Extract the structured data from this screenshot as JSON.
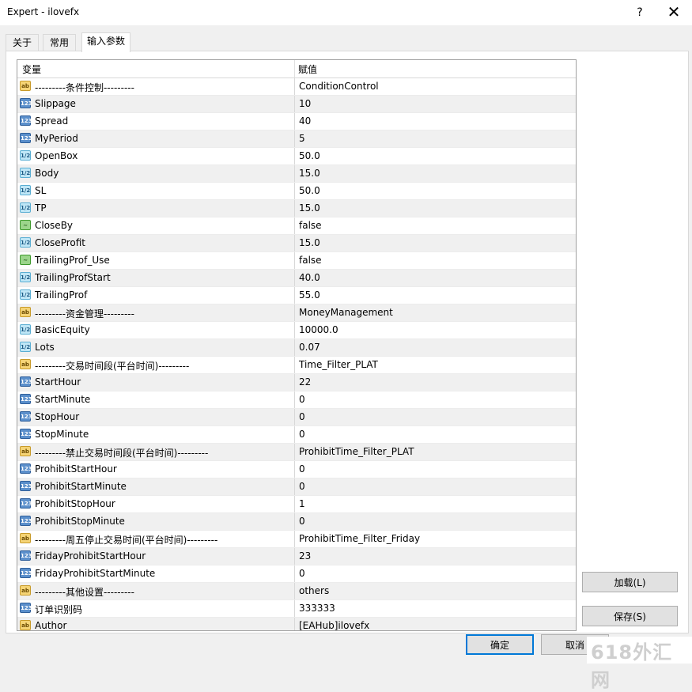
{
  "window": {
    "title": "Expert - ilovefx",
    "help_glyph": "?",
    "close_glyph": "✕"
  },
  "tabs": [
    "关于",
    "常用",
    "输入参数"
  ],
  "grid": {
    "headers": {
      "variable": "变量",
      "value": "赋值"
    },
    "rows": [
      {
        "type": "ab",
        "name": "---------条件控制---------",
        "value": "ConditionControl"
      },
      {
        "type": "int",
        "name": "Slippage",
        "value": "10"
      },
      {
        "type": "int",
        "name": "Spread",
        "value": "40"
      },
      {
        "type": "int",
        "name": "MyPeriod",
        "value": "5"
      },
      {
        "type": "dbl",
        "name": "OpenBox",
        "value": "50.0"
      },
      {
        "type": "dbl",
        "name": "Body",
        "value": "15.0"
      },
      {
        "type": "dbl",
        "name": "SL",
        "value": "50.0"
      },
      {
        "type": "dbl",
        "name": "TP",
        "value": "15.0"
      },
      {
        "type": "bool",
        "name": "CloseBy",
        "value": "false"
      },
      {
        "type": "dbl",
        "name": "CloseProfit",
        "value": "15.0"
      },
      {
        "type": "bool",
        "name": "TrailingProf_Use",
        "value": "false"
      },
      {
        "type": "dbl",
        "name": "TrailingProfStart",
        "value": "40.0"
      },
      {
        "type": "dbl",
        "name": "TrailingProf",
        "value": "55.0"
      },
      {
        "type": "ab",
        "name": "---------资金管理---------",
        "value": "MoneyManagement"
      },
      {
        "type": "dbl",
        "name": "BasicEquity",
        "value": "10000.0"
      },
      {
        "type": "dbl",
        "name": "Lots",
        "value": "0.07"
      },
      {
        "type": "ab",
        "name": "---------交易时间段(平台时间)---------",
        "value": "Time_Filter_PLAT"
      },
      {
        "type": "int",
        "name": "StartHour",
        "value": "22"
      },
      {
        "type": "int",
        "name": "StartMinute",
        "value": "0"
      },
      {
        "type": "int",
        "name": "StopHour",
        "value": "0"
      },
      {
        "type": "int",
        "name": "StopMinute",
        "value": "0"
      },
      {
        "type": "ab",
        "name": "---------禁止交易时间段(平台时间)---------",
        "value": "ProhibitTime_Filter_PLAT"
      },
      {
        "type": "int",
        "name": "ProhibitStartHour",
        "value": "0"
      },
      {
        "type": "int",
        "name": "ProhibitStartMinute",
        "value": "0"
      },
      {
        "type": "int",
        "name": "ProhibitStopHour",
        "value": "1"
      },
      {
        "type": "int",
        "name": "ProhibitStopMinute",
        "value": "0"
      },
      {
        "type": "ab",
        "name": "---------周五停止交易时间(平台时间)---------",
        "value": "ProhibitTime_Filter_Friday"
      },
      {
        "type": "int",
        "name": "FridayProhibitStartHour",
        "value": "23"
      },
      {
        "type": "int",
        "name": "FridayProhibitStartMinute",
        "value": "0"
      },
      {
        "type": "ab",
        "name": "---------其他设置---------",
        "value": "others"
      },
      {
        "type": "int",
        "name": "订单识别码",
        "value": "333333"
      },
      {
        "type": "ab",
        "name": "Author",
        "value": "[EAHub]ilovefx"
      }
    ]
  },
  "icon_types": {
    "ab": "ab",
    "int": "123",
    "dbl": "1/2",
    "bool": "~"
  },
  "buttons": {
    "load": "加载(L)",
    "save": "保存(S)",
    "ok": "确定",
    "cancel": "取消"
  },
  "watermark": "618外汇网"
}
